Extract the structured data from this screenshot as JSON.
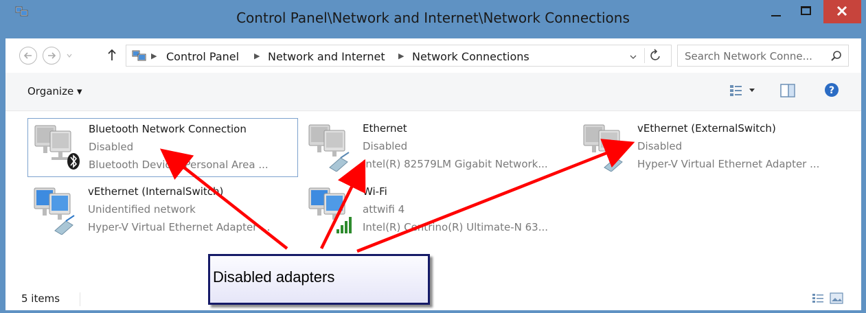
{
  "window": {
    "title": "Control Panel\\Network and Internet\\Network Connections",
    "close_glyph": "✕",
    "minimize_glyph": "—",
    "maximize_glyph": "☐"
  },
  "address": {
    "crumbs": [
      "Control Panel",
      "Network and Internet",
      "Network Connections"
    ],
    "search_placeholder": "Search Network Conne..."
  },
  "toolbar": {
    "organize_label": "Organize ▾"
  },
  "items": [
    {
      "name": "Bluetooth Network Connection",
      "status": "Disabled",
      "device": "Bluetooth Device (Personal Area ...",
      "icon": "bluetooth-adapter-icon"
    },
    {
      "name": "Ethernet",
      "status": "Disabled",
      "device": "Intel(R) 82579LM Gigabit Network...",
      "icon": "ethernet-adapter-icon"
    },
    {
      "name": "vEthernet (ExternalSwitch)",
      "status": "Disabled",
      "device": "Hyper-V Virtual Ethernet Adapter ...",
      "icon": "ethernet-adapter-icon"
    },
    {
      "name": "vEthernet (InternalSwitch)",
      "status": "Unidentified network",
      "device": "Hyper-V Virtual Ethernet Adapter ...",
      "icon": "ethernet-adapter-icon"
    },
    {
      "name": "Wi-Fi",
      "status": "attwifi  4",
      "device": "Intel(R) Centrino(R) Ultimate-N 63...",
      "icon": "wifi-adapter-icon"
    }
  ],
  "statusbar": {
    "count": "5 items"
  },
  "annotation": {
    "callout": "Disabled adapters"
  },
  "colors": {
    "titlebar": "#5f92c3",
    "close": "#c7443c",
    "arrow": "#ff0000",
    "callout_border": "#161b68"
  }
}
